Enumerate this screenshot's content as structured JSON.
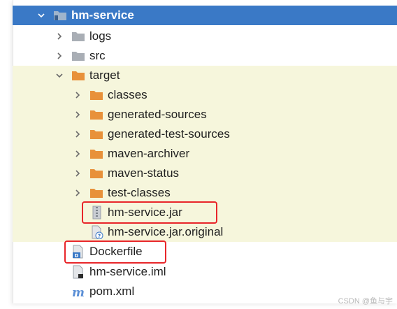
{
  "tree": {
    "root": {
      "label": "hm-service",
      "expanded": true
    },
    "logs": "logs",
    "src": "src",
    "target": {
      "label": "target",
      "expanded": true
    },
    "classes": "classes",
    "generated_sources": "generated-sources",
    "generated_test_sources": "generated-test-sources",
    "maven_archiver": "maven-archiver",
    "maven_status": "maven-status",
    "test_classes": "test-classes",
    "jar": "hm-service.jar",
    "jar_original": "hm-service.jar.original",
    "dockerfile": "Dockerfile",
    "iml": "hm-service.iml",
    "pom": "pom.xml"
  },
  "colors": {
    "selection": "#3a79c6",
    "target_tint": "#f6f6dc",
    "excluded_folder": "#e8913a",
    "plain_folder": "#a9aeb5",
    "highlight_box": "#e8262a"
  },
  "icons": {
    "root": "module-folder-icon",
    "folder": "folder-icon",
    "excluded_folder": "orange-folder-icon",
    "jar": "jar-archive-icon",
    "unknown_file": "unknown-file-icon",
    "dockerfile": "dockerfile-icon",
    "iml": "module-file-icon",
    "maven": "maven-icon"
  },
  "watermark": "CSDN @鱼与宇"
}
